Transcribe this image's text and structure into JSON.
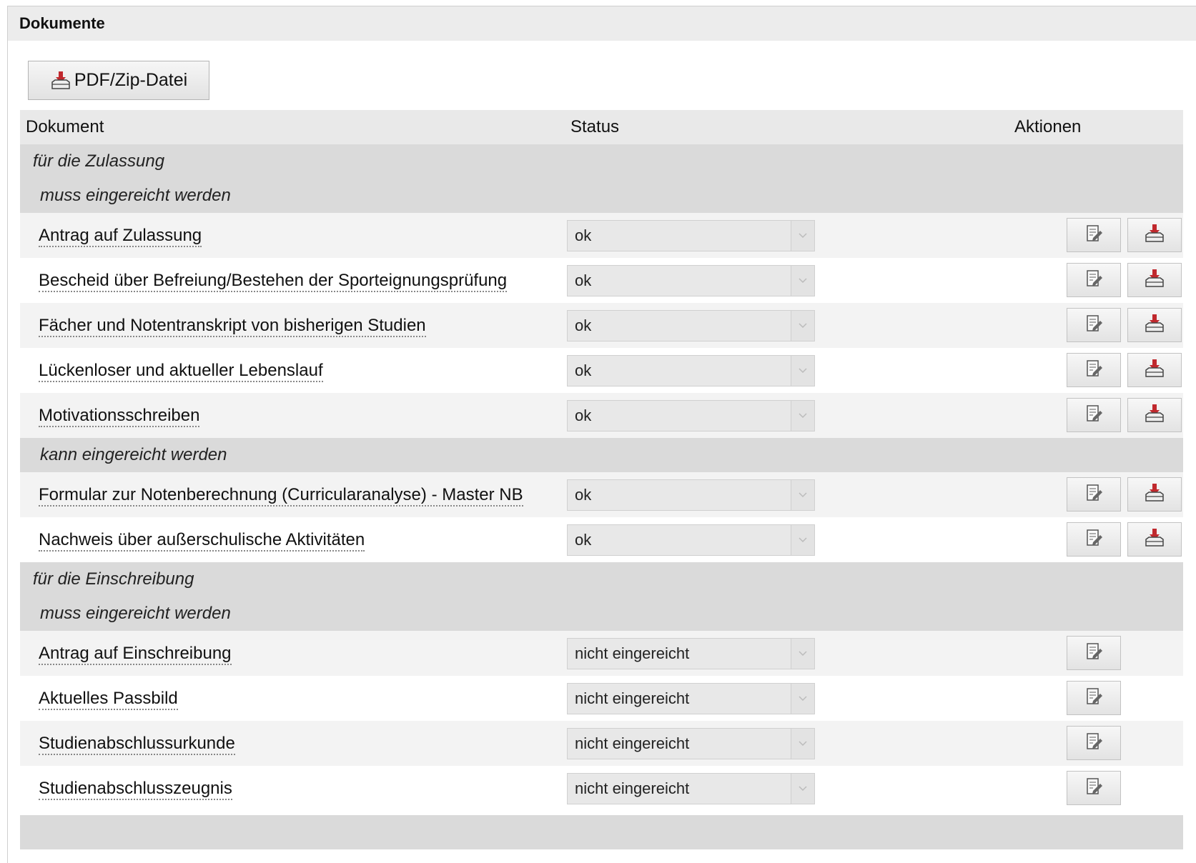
{
  "panel": {
    "title": "Dokumente"
  },
  "toolbar": {
    "pdf_zip_label": "PDF/Zip-Datei"
  },
  "table": {
    "headers": {
      "document": "Dokument",
      "status": "Status",
      "actions": "Aktionen"
    },
    "sections": [
      {
        "title": "für die Zulassung",
        "subsections": [
          {
            "title": "muss eingereicht werden",
            "rows": [
              {
                "name": "Antrag auf Zulassung",
                "status": "ok",
                "download": true
              },
              {
                "name": "Bescheid über Befreiung/Bestehen der Sporteignungsprüfung",
                "status": "ok",
                "download": true
              },
              {
                "name": "Fächer und Notentranskript von bisherigen Studien",
                "status": "ok",
                "download": true
              },
              {
                "name": "Lückenloser und aktueller Lebenslauf",
                "status": "ok",
                "download": true
              },
              {
                "name": "Motivationsschreiben",
                "status": "ok",
                "download": true
              }
            ]
          },
          {
            "title": "kann eingereicht werden",
            "rows": [
              {
                "name": "Formular zur Notenberechnung (Curricularanalyse) - Master NB",
                "status": "ok",
                "download": true
              },
              {
                "name": "Nachweis über außerschulische Aktivitäten",
                "status": "ok",
                "download": true
              }
            ]
          }
        ]
      },
      {
        "title": "für die Einschreibung",
        "subsections": [
          {
            "title": "muss eingereicht werden",
            "rows": [
              {
                "name": "Antrag auf Einschreibung",
                "status": "nicht eingereicht",
                "download": false
              },
              {
                "name": "Aktuelles Passbild",
                "status": "nicht eingereicht",
                "download": false
              },
              {
                "name": "Studienabschlussurkunde",
                "status": "nicht eingereicht",
                "download": false
              },
              {
                "name": "Studienabschlusszeugnis",
                "status": "nicht eingereicht",
                "download": false
              }
            ]
          }
        ]
      }
    ]
  },
  "icons": {
    "download": "download-tray-icon",
    "edit": "edit-document-icon",
    "dropdown": "chevron-down-icon"
  },
  "colors": {
    "header_bg": "#ececec",
    "group_bg": "#dadada",
    "download_red": "#c0282d"
  }
}
